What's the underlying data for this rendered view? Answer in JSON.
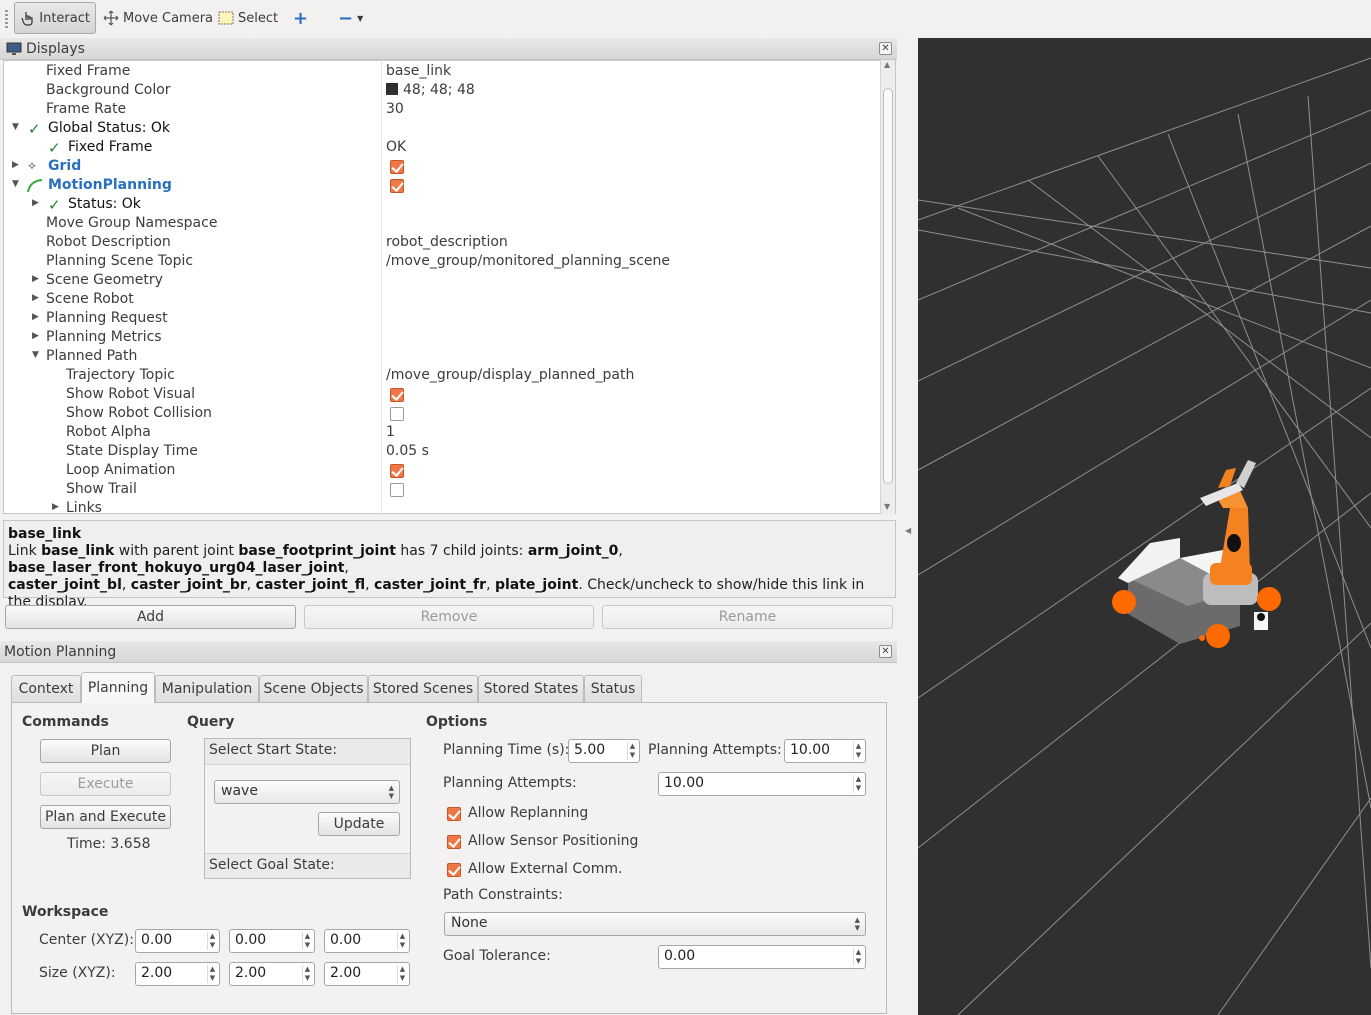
{
  "toolbar": {
    "interact": "Interact",
    "move_camera": "Move Camera",
    "select": "Select"
  },
  "displays": {
    "title": "Displays",
    "rows": [
      {
        "name": "Fixed Frame",
        "value": "base_link"
      },
      {
        "name": "Background Color",
        "value": "48; 48; 48"
      },
      {
        "name": "Frame Rate",
        "value": "30"
      },
      {
        "name": "Global Status: Ok",
        "value": ""
      },
      {
        "name": "Fixed Frame",
        "value": "OK"
      },
      {
        "name": "Grid",
        "value": ""
      },
      {
        "name": "MotionPlanning",
        "value": ""
      },
      {
        "name": "Status: Ok",
        "value": ""
      },
      {
        "name": "Move Group Namespace",
        "value": ""
      },
      {
        "name": "Robot Description",
        "value": "robot_description"
      },
      {
        "name": "Planning Scene Topic",
        "value": "/move_group/monitored_planning_scene"
      },
      {
        "name": "Scene Geometry",
        "value": ""
      },
      {
        "name": "Scene Robot",
        "value": ""
      },
      {
        "name": "Planning Request",
        "value": ""
      },
      {
        "name": "Planning Metrics",
        "value": ""
      },
      {
        "name": "Planned Path",
        "value": ""
      },
      {
        "name": "Trajectory Topic",
        "value": "/move_group/display_planned_path"
      },
      {
        "name": "Show Robot Visual",
        "value": ""
      },
      {
        "name": "Show Robot Collision",
        "value": ""
      },
      {
        "name": "Robot Alpha",
        "value": "1"
      },
      {
        "name": "State Display Time",
        "value": "0.05 s"
      },
      {
        "name": "Loop Animation",
        "value": ""
      },
      {
        "name": "Show Trail",
        "value": ""
      },
      {
        "name": "Links",
        "value": ""
      }
    ],
    "checks": {
      "grid": true,
      "motion_planning": true,
      "show_robot_visual": true,
      "show_robot_collision": false,
      "loop_animation": true,
      "show_trail": false
    },
    "background_color_hex": "#303030"
  },
  "description": {
    "title": "base_link",
    "t1": "Link ",
    "b1": "base_link",
    "t2": " with parent joint ",
    "b2": "base_footprint_joint",
    "t3": " has 7 child joints: ",
    "b3": "arm_joint_0",
    "t4": ", ",
    "b4": "base_laser_front_hokuyo_urg04_laser_joint",
    "t5": ",",
    "b5": "caster_joint_bl",
    "t6": ", ",
    "b6": "caster_joint_br",
    "t7": ", ",
    "b7": "caster_joint_fl",
    "t8": ", ",
    "b8": "caster_joint_fr",
    "t9": ", ",
    "b9": "plate_joint",
    "t10": ". Check/uncheck to show/hide this link in the display."
  },
  "buttons": {
    "add": "Add",
    "remove": "Remove",
    "rename": "Rename"
  },
  "motion_planning": {
    "title": "Motion Planning",
    "tabs": [
      "Context",
      "Planning",
      "Manipulation",
      "Scene Objects",
      "Stored Scenes",
      "Stored States",
      "Status"
    ],
    "selected_tab": "Planning",
    "commands": {
      "heading": "Commands",
      "plan": "Plan",
      "execute": "Execute",
      "plan_and_execute": "Plan and Execute",
      "time": "Time: 3.658"
    },
    "query": {
      "heading": "Query",
      "start_label": "Select Start State:",
      "start_value": "wave",
      "update": "Update",
      "goal_label": "Select Goal State:"
    },
    "options": {
      "heading": "Options",
      "planning_time_label": "Planning Time (s):",
      "planning_time": "5.00",
      "planning_attempts_label": "Planning Attempts:",
      "planning_attempts": "10.00",
      "planning_attempts_label2": "Planning Attempts:",
      "planning_attempts2": "10.00",
      "allow_replanning": "Allow Replanning",
      "allow_sensor_positioning": "Allow Sensor Positioning",
      "allow_external_comm": "Allow External Comm.",
      "path_constraints_label": "Path Constraints:",
      "path_constraints": "None",
      "goal_tolerance_label": "Goal Tolerance:",
      "goal_tolerance": "0.00"
    },
    "workspace": {
      "heading": "Workspace",
      "center_label": "Center (XYZ):",
      "center": [
        "0.00",
        "0.00",
        "0.00"
      ],
      "size_label": "Size (XYZ):",
      "size": [
        "2.00",
        "2.00",
        "2.00"
      ]
    }
  },
  "colors": {
    "accent": "#f07746",
    "robot_orange": "#f5821f",
    "viewport_bg": "#303030",
    "link_blue": "#2a6fc0"
  }
}
